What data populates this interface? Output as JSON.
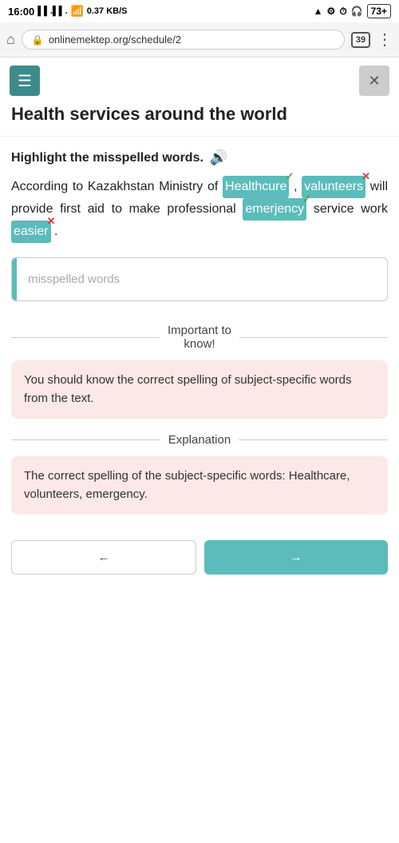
{
  "statusBar": {
    "time": "16:00",
    "signal1": "▌▌",
    "signal2": "▌▌",
    "wifi": "0.37 KB/S",
    "batteryLabel": "73+"
  },
  "browserBar": {
    "url": "onlinemektep.org/schedule/2",
    "tabCount": "39"
  },
  "toolbar": {
    "hamburgerLabel": "☰",
    "closeLabel": "✕"
  },
  "pageTitle": "Health services around the world",
  "sectionLabel": "Highlight the misspelled words.",
  "passage": {
    "pre1": "According to Kazakhstan Ministry of",
    "word1": "Healthcure",
    "word1Badge": "✓",
    "word1BadgeType": "correct",
    "mid1": ", valunteers",
    "word2": "valunteers",
    "word2Badge": "✕",
    "word2BadgeType": "wrong",
    "mid2": " will provide first aid to make professional",
    "word3": "emerjency",
    "word3Badge": "✓",
    "word3BadgeType": "correct",
    "mid3": " service work",
    "word4": "easier",
    "word4Badge": "✕",
    "word4BadgeType": "wrong",
    "end": "."
  },
  "inputPlaceholder": "misspelled words",
  "dividerImportant": {
    "label": "Important to\nknow!"
  },
  "infoBoxImportant": "You should know the correct spelling of subject-specific words from the text.",
  "dividerExplanation": {
    "label": "Explanation"
  },
  "infoBoxExplanation": "The correct spelling of the subject-specific words: Healthcare, volunteers, emergency.",
  "buttons": {
    "back": "←",
    "next": "→"
  }
}
